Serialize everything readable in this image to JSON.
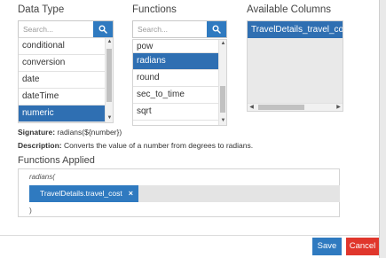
{
  "data_type": {
    "label": "Data Type",
    "search_placeholder": "Search...",
    "items": [
      "conditional",
      "conversion",
      "date",
      "dateTime",
      "numeric"
    ],
    "selected_index": 4
  },
  "functions": {
    "label": "Functions",
    "search_placeholder": "Search...",
    "items": [
      "pow",
      "radians",
      "round",
      "sec_to_time",
      "sqrt"
    ],
    "selected_index": 1
  },
  "available_columns": {
    "label": "Available Columns",
    "items": [
      "TravelDetails_travel_cost"
    ]
  },
  "signature": {
    "label": "Signature:",
    "value": "radians(${number})"
  },
  "description": {
    "label": "Description:",
    "value": "Converts the value of a number from degrees to radians."
  },
  "functions_applied": {
    "label": "Functions Applied",
    "function_open": "radians(",
    "chip_label": "TravelDetails.travel_cost",
    "chip_remove": "×",
    "function_close": ")"
  },
  "buttons": {
    "save": "Save",
    "cancel": "Cancel"
  },
  "colors": {
    "accent": "#2f7ac0",
    "selected": "#2f6fb2",
    "danger": "#e0362c"
  },
  "icons": {
    "search": "search-icon",
    "scroll_up": "chevron-up-icon",
    "scroll_down": "chevron-down-icon",
    "scroll_left": "chevron-left-icon",
    "scroll_right": "chevron-right-icon"
  }
}
